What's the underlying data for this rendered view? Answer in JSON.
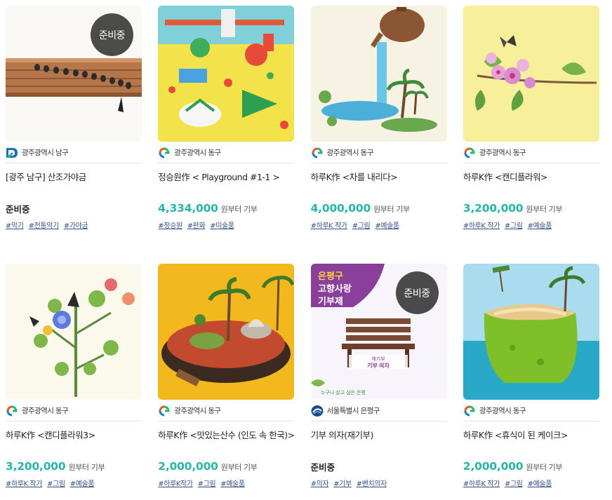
{
  "cards": [
    {
      "org": "광주광역시 남구",
      "title": "[광주 남구] 산조가야금",
      "status": "준비중",
      "price": "",
      "price_suffix": "",
      "badge": "준비중",
      "tags": [
        "#악기",
        "#전통악기",
        "#가야금"
      ]
    },
    {
      "org": "광주광역시 동구",
      "title": "정승원作 < Playground #1-1 >",
      "status": "",
      "price": "4,334,000",
      "price_suffix": "원부터 기부",
      "badge": "",
      "tags": [
        "#정승원",
        "#판화",
        "#미술품"
      ]
    },
    {
      "org": "광주광역시 동구",
      "title": "하루K作 <차를 내리다>",
      "status": "",
      "price": "4,000,000",
      "price_suffix": "원부터 기부",
      "badge": "",
      "tags": [
        "#하루K 작가",
        "#그림",
        "#예술품"
      ]
    },
    {
      "org": "광주광역시 동구",
      "title": "하루K作 <캔디플라워>",
      "status": "",
      "price": "3,200,000",
      "price_suffix": "원부터 기부",
      "badge": "",
      "tags": [
        "#하루K 작가",
        "#그림",
        "#예술품"
      ]
    },
    {
      "org": "광주광역시 동구",
      "title": "하루K作 <캔디플라워3>",
      "status": "",
      "price": "3,200,000",
      "price_suffix": "원부터 기부",
      "badge": "",
      "tags": [
        "#하루K 작가",
        "#그림",
        "#예술품"
      ]
    },
    {
      "org": "광주광역시 동구",
      "title": "하루K作 <맛있는산수 (인도 속 한국)>",
      "status": "",
      "price": "2,000,000",
      "price_suffix": "원부터 기부",
      "badge": "",
      "tags": [
        "#하루K작가",
        "#그림",
        "#예술품"
      ]
    },
    {
      "org": "서울특별시 은평구",
      "title": "기부 의자(재기부)",
      "status": "준비중",
      "price": "",
      "price_suffix": "",
      "badge": "준비중",
      "tags": [
        "#의자",
        "#기부",
        "#벤치의자"
      ],
      "art_text": {
        "line1": "은평구",
        "line2": "고향사랑",
        "line3": "기부제",
        "caption1": "재기부",
        "caption2": "기부 의자",
        "footer": "누구나 살고 싶은 은평"
      }
    },
    {
      "org": "광주광역시 동구",
      "title": "하루K作 <휴식이 된 케이크>",
      "status": "",
      "price": "2,000,000",
      "price_suffix": "원부터 기부",
      "badge": "",
      "tags": [
        "#하루K 작가",
        "#그림",
        "#예술품"
      ]
    }
  ],
  "colors": {
    "price": "#28b5a8",
    "tag": "#3a4f86",
    "badge_bg": "#373737"
  }
}
